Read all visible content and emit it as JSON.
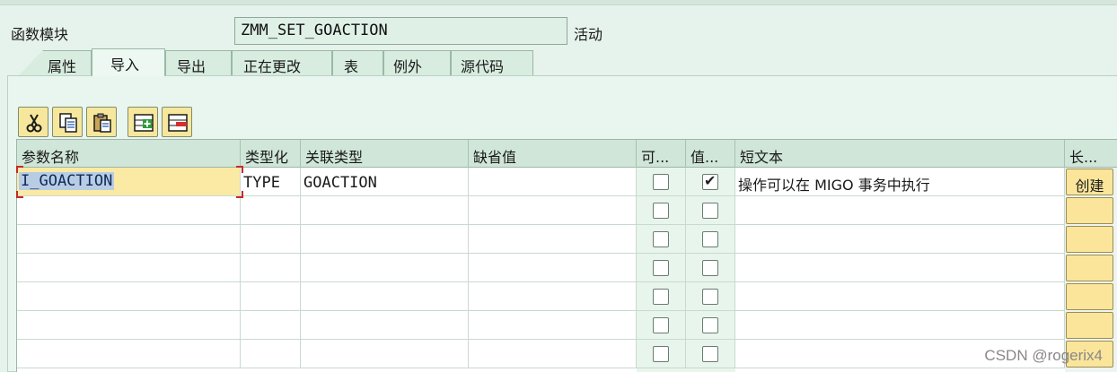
{
  "header": {
    "function_module_label": "函数模块",
    "function_module_name": "ZMM_SET_GOACTION",
    "status": "活动"
  },
  "tabs": [
    {
      "label": "属性",
      "active": false
    },
    {
      "label": "导入",
      "active": true
    },
    {
      "label": "导出",
      "active": false
    },
    {
      "label": "正在更改",
      "active": false
    },
    {
      "label": "表",
      "active": false
    },
    {
      "label": "例外",
      "active": false
    },
    {
      "label": "源代码",
      "active": false
    }
  ],
  "toolbar": {
    "buttons": [
      "cut-icon",
      "copy-icon",
      "paste-icon",
      "insert-row-icon",
      "delete-row-icon"
    ]
  },
  "table": {
    "columns": [
      "参数名称",
      "类型化",
      "关联类型",
      "缺省值",
      "可...",
      "值...",
      "短文本",
      "长..."
    ],
    "rows": [
      {
        "name": "I_GOACTION",
        "typing": "TYPE",
        "assoc_type": "GOACTION",
        "default": "",
        "optional": false,
        "pass_value": true,
        "short_text": "操作可以在 MIGO 事务中执行",
        "long_text_button": "创建"
      },
      {
        "name": "",
        "typing": "",
        "assoc_type": "",
        "default": "",
        "optional": false,
        "pass_value": false,
        "short_text": "",
        "long_text_button": ""
      },
      {
        "name": "",
        "typing": "",
        "assoc_type": "",
        "default": "",
        "optional": false,
        "pass_value": false,
        "short_text": "",
        "long_text_button": ""
      },
      {
        "name": "",
        "typing": "",
        "assoc_type": "",
        "default": "",
        "optional": false,
        "pass_value": false,
        "short_text": "",
        "long_text_button": ""
      },
      {
        "name": "",
        "typing": "",
        "assoc_type": "",
        "default": "",
        "optional": false,
        "pass_value": false,
        "short_text": "",
        "long_text_button": ""
      },
      {
        "name": "",
        "typing": "",
        "assoc_type": "",
        "default": "",
        "optional": false,
        "pass_value": false,
        "short_text": "",
        "long_text_button": ""
      },
      {
        "name": "",
        "typing": "",
        "assoc_type": "",
        "default": "",
        "optional": false,
        "pass_value": false,
        "short_text": "",
        "long_text_button": ""
      }
    ]
  },
  "watermark": "CSDN @rogerix4",
  "colors": {
    "background": "#e6f2ec",
    "header_row": "#d0e6d9",
    "button_yellow": "#f7e79d",
    "selection": "#b8cde4",
    "focus_red": "#c62828"
  }
}
